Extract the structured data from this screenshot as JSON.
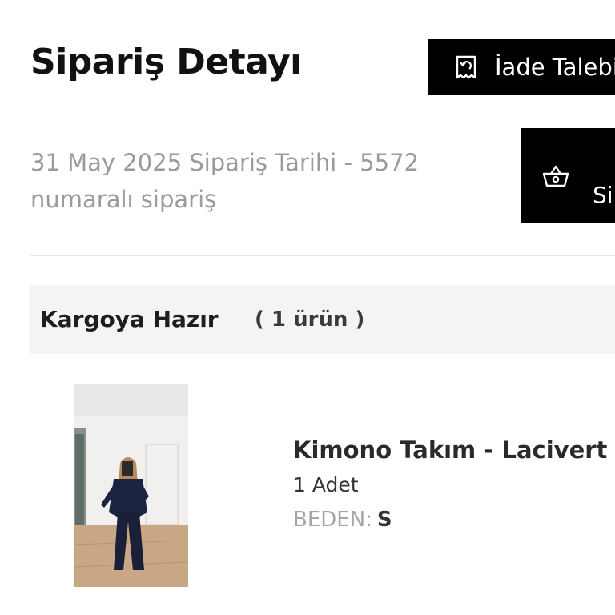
{
  "header": {
    "title": "Sipariş Detayı",
    "return_button_label": "İade Talebi",
    "reorder_button_label": "Si"
  },
  "order": {
    "meta_line1": "31 May 2025 Sipariş Tarihi - 5572",
    "meta_line2": "numaralı sipariş"
  },
  "shipment": {
    "status": "Kargoya Hazır",
    "count": "( 1 ürün )"
  },
  "product": {
    "name": "Kimono Takım - Lacivert",
    "quantity": "1 Adet",
    "size_label": "BEDEN:",
    "size_value": "S"
  },
  "icons": {
    "return": "return-receipt-icon",
    "reorder": "shopping-basket-icon"
  },
  "colors": {
    "button_bg": "#000000",
    "status_bar_bg": "#f4f4f5",
    "muted_text": "#9b9b9b"
  }
}
